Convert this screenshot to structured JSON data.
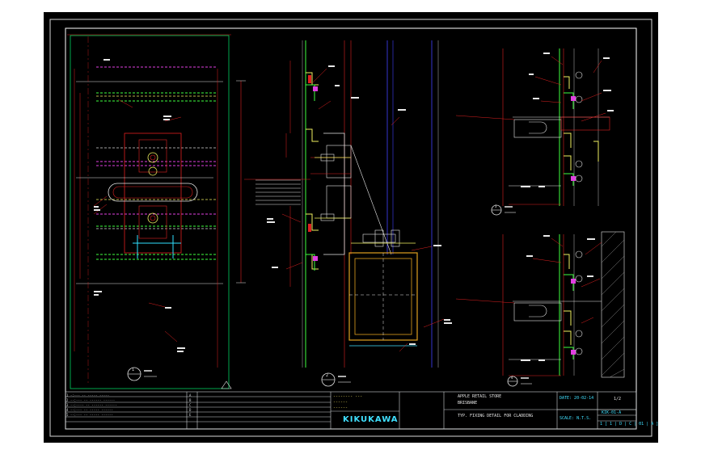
{
  "title_block": {
    "revisions": [
      "1  -:--- -- -----  -----",
      "2  --:--- -- ------ ------",
      "3  --:---- -- ------ ------",
      "4  --:--- -- ----- ------",
      "5  --:--- -- ----- ------"
    ],
    "rev_marks": [
      "A",
      "B",
      "C",
      "D",
      "E"
    ],
    "drawn_by": "-------- ---",
    "checked_by": "------",
    "approved_by": "------",
    "company": "KIKUKAWA",
    "project": "APPLE RETAIL STORE",
    "location": "BRISBANE",
    "drawing_title": "TYP. FIXING DETAIL FOR CLADDING",
    "date": "DATE: 20-02-14",
    "scale": "SCALE: N.T.S.",
    "sheet": "1/2",
    "drawing_no": "KIK-01-A",
    "rev": "1 [ 1 | D | C | 01 | A ]"
  },
  "section_marks": {
    "left": "1",
    "middle": "2",
    "right_top": "3",
    "right_bottom": "4"
  }
}
